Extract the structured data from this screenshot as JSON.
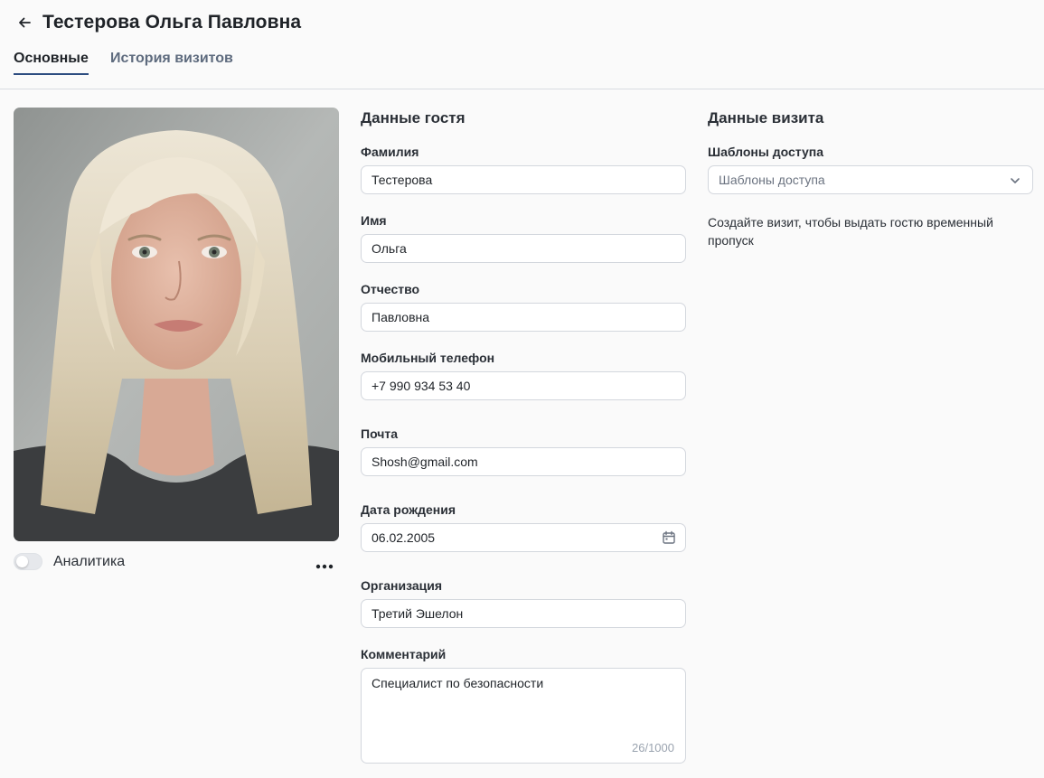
{
  "header": {
    "title": "Тестерова Ольга Павловна",
    "tabs": [
      "Основные",
      "История визитов"
    ]
  },
  "photo": {
    "analytics_label": "Аналитика",
    "analytics_enabled": false
  },
  "guest": {
    "section_title": "Данные гостя",
    "fields": [
      {
        "label": "Фамилия",
        "value": "Тестерова"
      },
      {
        "label": "Имя",
        "value": "Ольга"
      },
      {
        "label": "Отчество",
        "value": "Павловна"
      },
      {
        "label": "Мобильный телефон",
        "value": "+7 990 934 53 40"
      },
      {
        "label": "Почта",
        "value": "Shosh@gmail.com"
      },
      {
        "label": "Дата рождения",
        "value": "06.02.2005"
      },
      {
        "label": "Организация",
        "value": "Третий Эшелон"
      }
    ],
    "comment": {
      "label": "Комментарий",
      "value": "Специалист по безопасности",
      "counter": "26/1000"
    }
  },
  "visit": {
    "section_title": "Данные визита",
    "access_label": "Шаблоны доступа",
    "access_placeholder": "Шаблоны доступа",
    "hint": "Создайте визит, чтобы выдать гостю временный пропуск"
  },
  "colors": {
    "accent": "#2d4d80",
    "background": "#fafafa",
    "border": "#d3d7dd"
  }
}
